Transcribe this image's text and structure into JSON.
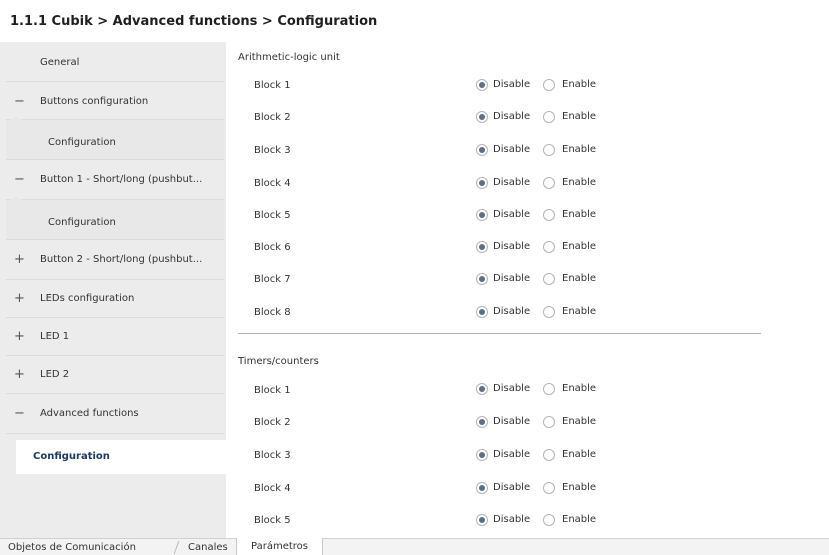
{
  "header": {
    "breadcrumb": "1.1.1 Cubik > Advanced functions > Configuration"
  },
  "sidebar": {
    "items": [
      {
        "label": "General",
        "sign": ""
      },
      {
        "label": "Buttons configuration",
        "sign": "−"
      },
      {
        "label": "Configuration",
        "sign": ""
      },
      {
        "label": "Button 1 - Short/long (pushbut...",
        "sign": "−"
      },
      {
        "label": "Configuration",
        "sign": ""
      },
      {
        "label": "Button 2 - Short/long (pushbut...",
        "sign": "+"
      },
      {
        "label": "LEDs configuration",
        "sign": "+"
      },
      {
        "label": "LED 1",
        "sign": "+"
      },
      {
        "label": "LED 2",
        "sign": "+"
      },
      {
        "label": "Advanced functions",
        "sign": "−"
      },
      {
        "label": "Configuration",
        "sign": ""
      }
    ]
  },
  "options": {
    "disable": "Disable",
    "enable": "Enable"
  },
  "sections": [
    {
      "title": "Arithmetic-logic unit",
      "rows": [
        {
          "label": "Block 1",
          "selected": "Disable"
        },
        {
          "label": "Block 2",
          "selected": "Disable"
        },
        {
          "label": "Block 3",
          "selected": "Disable"
        },
        {
          "label": "Block 4",
          "selected": "Disable"
        },
        {
          "label": "Block 5",
          "selected": "Disable"
        },
        {
          "label": "Block 6",
          "selected": "Disable"
        },
        {
          "label": "Block 7",
          "selected": "Disable"
        },
        {
          "label": "Block 8",
          "selected": "Disable"
        }
      ]
    },
    {
      "title": "Timers/counters",
      "rows": [
        {
          "label": "Block 1",
          "selected": "Disable"
        },
        {
          "label": "Block 2",
          "selected": "Disable"
        },
        {
          "label": "Block 3",
          "selected": "Disable"
        },
        {
          "label": "Block 4",
          "selected": "Disable"
        },
        {
          "label": "Block 5",
          "selected": "Disable"
        }
      ]
    }
  ],
  "tabs": [
    {
      "label": "Objetos de Comunicación"
    },
    {
      "label": "Canales"
    },
    {
      "label": "Parámetros"
    }
  ]
}
